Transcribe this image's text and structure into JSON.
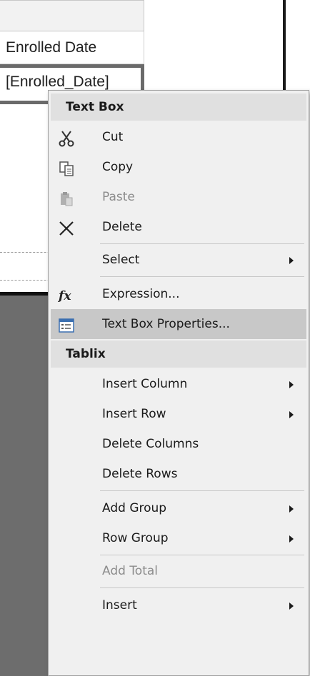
{
  "report": {
    "column_header": "Enrolled Date",
    "data_cell": "[Enrolled_Date]"
  },
  "context_menu": {
    "sections": [
      {
        "title": "Text Box",
        "items": [
          {
            "label": "Cut",
            "icon": "scissors-icon",
            "enabled": true
          },
          {
            "label": "Copy",
            "icon": "copy-icon",
            "enabled": true
          },
          {
            "label": "Paste",
            "icon": "paste-icon",
            "enabled": false
          },
          {
            "label": "Delete",
            "icon": "delete-x-icon",
            "enabled": true
          },
          {
            "label": "Select",
            "submenu": true,
            "enabled": true
          },
          {
            "label": "Expression...",
            "icon": "fx-icon",
            "enabled": true
          },
          {
            "label": "Text Box Properties...",
            "icon": "properties-icon",
            "enabled": true,
            "highlighted": true
          }
        ]
      },
      {
        "title": "Tablix",
        "items": [
          {
            "label": "Insert Column",
            "submenu": true,
            "enabled": true
          },
          {
            "label": "Insert Row",
            "submenu": true,
            "enabled": true
          },
          {
            "label": "Delete Columns",
            "enabled": true
          },
          {
            "label": "Delete Rows",
            "enabled": true
          },
          {
            "label": "Add Group",
            "submenu": true,
            "enabled": true
          },
          {
            "label": "Row Group",
            "submenu": true,
            "enabled": true
          },
          {
            "label": "Add Total",
            "enabled": false
          },
          {
            "label": "Insert",
            "submenu": true,
            "enabled": true
          }
        ]
      }
    ]
  }
}
